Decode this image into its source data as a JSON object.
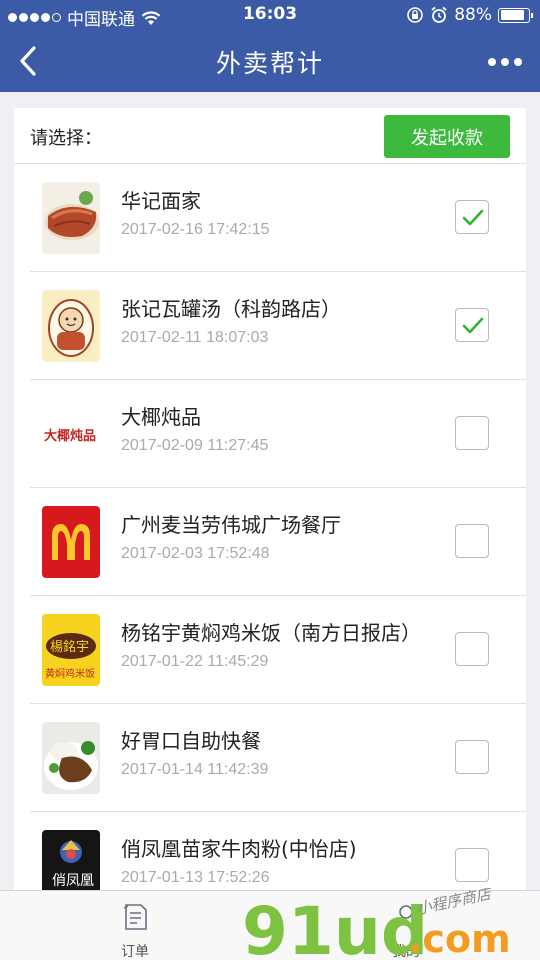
{
  "status_bar": {
    "carrier": "中国联通",
    "time": "16:03",
    "battery_text": "88%",
    "battery_level": 0.88,
    "icons": [
      "signal-dots-icon",
      "wifi-icon",
      "orientation-lock-icon",
      "alarm-icon",
      "battery-icon"
    ]
  },
  "nav": {
    "title": "外卖帮计",
    "back_icon": "chevron-left-icon",
    "more_icon": "more-dots-icon"
  },
  "header": {
    "choose_label": "请选择：",
    "pay_button": "发起收款"
  },
  "items": [
    {
      "name": "华记面家",
      "time": "2017-02-16 17:42:15",
      "checked": true
    },
    {
      "name": "张记瓦罐汤（科韵路店）",
      "time": "2017-02-11 18:07:03",
      "checked": true
    },
    {
      "name": "大椰炖品",
      "time": "2017-02-09 11:27:45",
      "checked": false
    },
    {
      "name": "广州麦当劳伟城广场餐厅",
      "time": "2017-02-03 17:52:48",
      "checked": false
    },
    {
      "name": "杨铭宇黄焖鸡米饭（南方日报店）",
      "time": "2017-01-22 11:45:29",
      "checked": false
    },
    {
      "name": "好胃口自助快餐",
      "time": "2017-01-14 11:42:39",
      "checked": false
    },
    {
      "name": "俏凤凰苗家牛肉粉(中怡店)",
      "time": "2017-01-13 17:52:26",
      "checked": false
    }
  ],
  "logos": {
    "dayei": "大椰炖品",
    "yangmingyu_top": "楊銘宇",
    "yangmingyu_bottom": "黄焖鸡米饭",
    "qiaofenghuang": "俏凤凰"
  },
  "tabs": [
    {
      "label": "订单",
      "icon": "order-list-icon"
    },
    {
      "label": "我的",
      "icon": "user-icon"
    }
  ],
  "watermark": {
    "main": "91ud",
    "suffix": ".com",
    "tagline": "小程序商店"
  },
  "colors": {
    "primary": "#3b5ba7",
    "button_green": "#3dba3d",
    "check_green": "#2eb52e",
    "watermark_green": "#7ec242",
    "watermark_orange": "#f39c1f"
  }
}
